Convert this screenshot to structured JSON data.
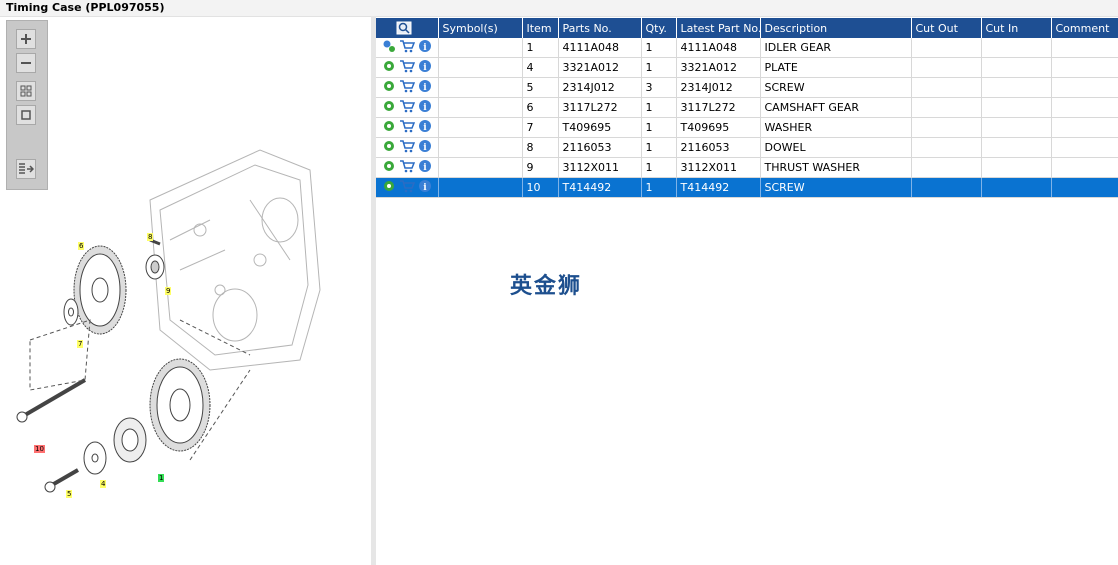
{
  "window": {
    "title": "Timing Case (PPL097055)"
  },
  "toolbox": {
    "buttons": [
      {
        "name": "zoom-in-icon"
      },
      {
        "name": "zoom-out-icon"
      },
      {
        "name": "fit-all-icon"
      },
      {
        "name": "fit-page-icon"
      },
      {
        "name": "export-icon"
      }
    ]
  },
  "drawing": {
    "callouts": [
      {
        "label": "6",
        "color": "#ffff66"
      },
      {
        "label": "8",
        "color": "#ffff66"
      },
      {
        "label": "9",
        "color": "#ffff66"
      },
      {
        "label": "7",
        "color": "#ffff66"
      },
      {
        "label": "10",
        "color": "#ff7070"
      },
      {
        "label": "4",
        "color": "#ffff66"
      },
      {
        "label": "5",
        "color": "#ffff66"
      },
      {
        "label": "1",
        "color": "#33dd55"
      }
    ]
  },
  "table": {
    "headers": [
      "",
      "Symbol(s)",
      "Item",
      "Parts No.",
      "Qty.",
      "Latest Part No.",
      "Description",
      "Cut Out",
      "Cut In",
      "Comment"
    ],
    "rows": [
      {
        "symbol": "",
        "item": "1",
        "parts_no": "4111A048",
        "qty": "1",
        "latest": "4111A048",
        "description": "IDLER GEAR",
        "cut_out": "",
        "cut_in": "",
        "comment": "",
        "gear": "multi-gear-icon"
      },
      {
        "symbol": "",
        "item": "4",
        "parts_no": "3321A012",
        "qty": "1",
        "latest": "3321A012",
        "description": "PLATE",
        "cut_out": "",
        "cut_in": "",
        "comment": "",
        "gear": "gear-icon"
      },
      {
        "symbol": "",
        "item": "5",
        "parts_no": "2314J012",
        "qty": "3",
        "latest": "2314J012",
        "description": "SCREW",
        "cut_out": "",
        "cut_in": "",
        "comment": "",
        "gear": "gear-icon"
      },
      {
        "symbol": "",
        "item": "6",
        "parts_no": "3117L272",
        "qty": "1",
        "latest": "3117L272",
        "description": "CAMSHAFT GEAR",
        "cut_out": "",
        "cut_in": "",
        "comment": "",
        "gear": "gear-icon"
      },
      {
        "symbol": "",
        "item": "7",
        "parts_no": "T409695",
        "qty": "1",
        "latest": "T409695",
        "description": "WASHER",
        "cut_out": "",
        "cut_in": "",
        "comment": "",
        "gear": "gear-icon"
      },
      {
        "symbol": "",
        "item": "8",
        "parts_no": "2116053",
        "qty": "1",
        "latest": "2116053",
        "description": "DOWEL",
        "cut_out": "",
        "cut_in": "",
        "comment": "",
        "gear": "gear-icon"
      },
      {
        "symbol": "",
        "item": "9",
        "parts_no": "3112X011",
        "qty": "1",
        "latest": "3112X011",
        "description": "THRUST WASHER",
        "cut_out": "",
        "cut_in": "",
        "comment": "",
        "gear": "gear-icon"
      },
      {
        "symbol": "",
        "item": "10",
        "parts_no": "T414492",
        "qty": "1",
        "latest": "T414492",
        "description": "SCREW",
        "cut_out": "",
        "cut_in": "",
        "comment": "",
        "gear": "gear-icon",
        "selected": true
      }
    ]
  },
  "watermark": "英金狮",
  "colors": {
    "header_bg": "#1e4f93",
    "selected_row": "#0a73d1",
    "gear_green": "#3aa83a",
    "cart_blue": "#2b6cc4",
    "info_blue": "#3a7fd5"
  }
}
